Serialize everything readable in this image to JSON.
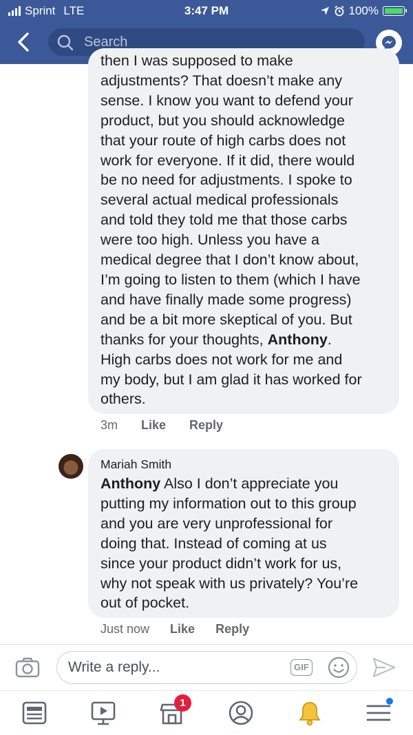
{
  "status_bar": {
    "carrier": "Sprint",
    "network": "LTE",
    "time": "3:47 PM",
    "battery": "100%",
    "battery_level": 1.0
  },
  "header": {
    "search_placeholder": "Search"
  },
  "comments": [
    {
      "lines": [
        "then I was supposed to make",
        "adjustments? That doesn’t make any",
        "sense. I know you want to defend your",
        "product, but you should acknowledge",
        "that your route of high carbs does not",
        "work for everyone. If it did, there would",
        "be no need for adjustments. I spoke to",
        "several actual medical professionals",
        "and told they told me that those carbs",
        "were too high. Unless you have a",
        "medical degree that I don’t know about,",
        "I’m going to listen to them (which I have",
        "and have finally made some progress)",
        "and be a bit more skeptical of you. But"
      ],
      "line15_before": "thanks for your thoughts, ",
      "line15_mention": "Anthony",
      "line15_after": ".",
      "lines_end": [
        "High carbs does not work for me and",
        "my body, but I am glad it has worked for",
        "others."
      ],
      "time": "3m",
      "like": "Like",
      "reply": "Reply"
    },
    {
      "author": "Mariah Smith",
      "mention": "Anthony",
      "first_line_rest": " Also I don’t appreciate you",
      "lines": [
        "putting my information out to this group",
        "and you are very unprofessional for",
        "doing that. Instead of coming at us",
        "since your product didn’t work for us,",
        "why not speak with us privately? You’re",
        "out of pocket."
      ],
      "time": "Just now",
      "like": "Like",
      "reply": "Reply"
    }
  ],
  "reply_bar": {
    "placeholder": "Write a reply...",
    "gif_label": "GIF"
  },
  "tab_bar": {
    "marketplace_badge": "1"
  }
}
